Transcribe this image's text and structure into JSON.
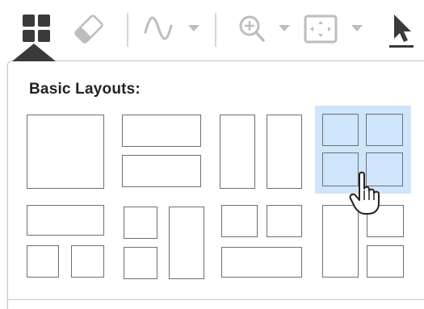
{
  "toolbar": {
    "items": [
      {
        "name": "layout-grid-icon",
        "active": true
      },
      {
        "name": "eraser-icon"
      },
      {
        "name": "signal-wave-icon",
        "has_dropdown": true
      },
      {
        "name": "zoom-in-icon",
        "has_dropdown": true
      },
      {
        "name": "fit-to-view-icon",
        "has_dropdown": true
      },
      {
        "name": "pointer-select-icon"
      }
    ]
  },
  "panel": {
    "title": "Basic Layouts:",
    "selected_index": 3,
    "layouts": [
      {
        "name": "layout-1x1"
      },
      {
        "name": "layout-2-rows"
      },
      {
        "name": "layout-2-columns"
      },
      {
        "name": "layout-2x2"
      },
      {
        "name": "layout-1-top-2-bottom"
      },
      {
        "name": "layout-2-left-1-right"
      },
      {
        "name": "layout-2-top-1-bottom"
      },
      {
        "name": "layout-1-left-2-right"
      }
    ]
  },
  "colors": {
    "selected_bg": "#cfe5fb",
    "cell_border": "#6f6f6f",
    "icon_dark": "#3a3a3a",
    "icon_light": "#bdbdbd"
  }
}
